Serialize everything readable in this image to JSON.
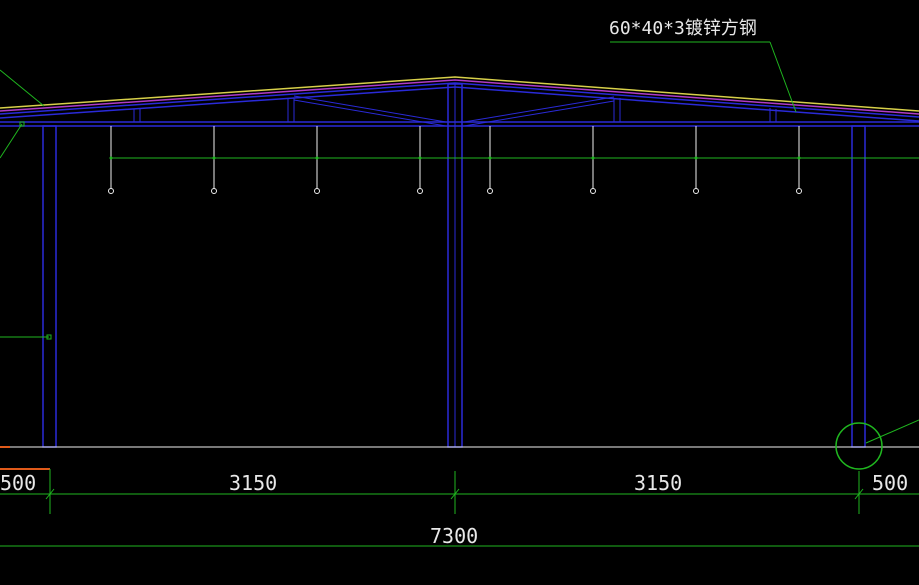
{
  "drawing": {
    "callout_label": "60*40*3镀锌方钢",
    "dimensions": {
      "left_partial": "500",
      "span_left": "3150",
      "span_right": "3150",
      "right_partial": "500",
      "total": "7300"
    },
    "colors": {
      "background": "#000000",
      "structure": "#2a2ad8",
      "leader": "#1fb61f",
      "dimension": "#1fb61f",
      "rafter_top": "#d8d04a",
      "rafter_mid": "#b03cc8",
      "ground": "#f0f0f0",
      "text": "#e8e8e8",
      "hanger": "#f0f0f0",
      "accent": "#e05a1a"
    }
  }
}
